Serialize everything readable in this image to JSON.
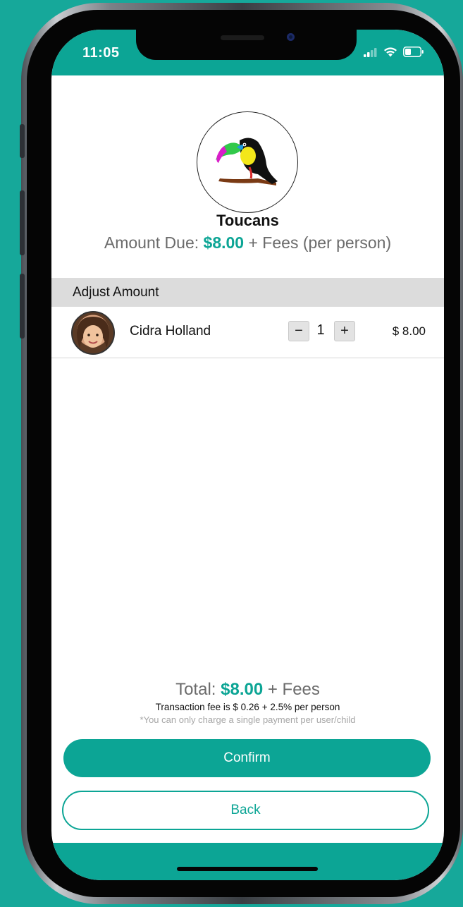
{
  "status_bar": {
    "time": "11:05",
    "icons": [
      "cellular-signal-icon",
      "wifi-icon",
      "battery-icon"
    ]
  },
  "group": {
    "logo_icon": "toucan-logo",
    "name": "Toucans",
    "amount_due_prefix": "Amount Due:",
    "amount_due_value": "$8.00",
    "amount_due_suffix": "+ Fees (per person)"
  },
  "adjust_section": {
    "header": "Adjust Amount",
    "members": [
      {
        "name": "Cidra Holland",
        "quantity": "1",
        "minus_label": "−",
        "plus_label": "+",
        "price": "$ 8.00"
      }
    ]
  },
  "summary": {
    "total_prefix": "Total:",
    "total_value": "$8.00",
    "total_suffix": "+ Fees",
    "fee_note": "Transaction fee is $ 0.26 + 2.5% per person",
    "single_payment_note": "*You can only charge a single payment per user/child"
  },
  "actions": {
    "confirm_label": "Confirm",
    "back_label": "Back"
  },
  "colors": {
    "accent": "#0ca595",
    "background": "#16a89a",
    "section_header": "#dcdcdc"
  }
}
